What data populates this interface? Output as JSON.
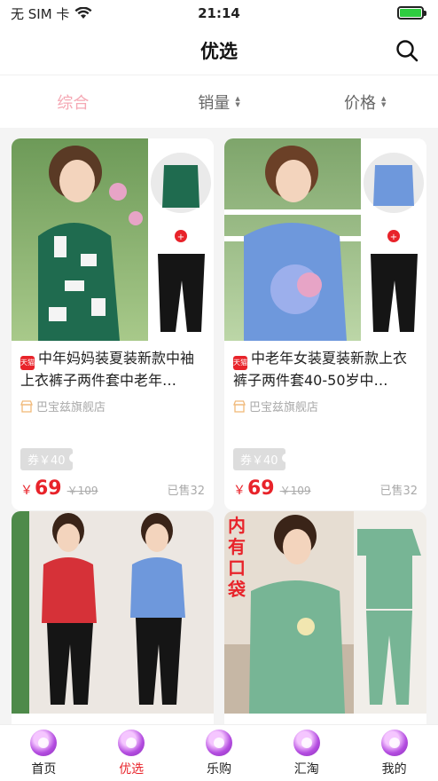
{
  "status": {
    "carrier": "无 SIM 卡",
    "time": "21:14"
  },
  "nav": {
    "title": "优选"
  },
  "filters": [
    {
      "label": "综合",
      "active": true
    },
    {
      "label": "销量",
      "active": false
    },
    {
      "label": "价格",
      "active": false
    }
  ],
  "products": [
    {
      "title": "中年妈妈装夏装新款中袖上衣裤子两件套中老年…",
      "badge": "天猫",
      "shop": "巴宝兹旗舰店",
      "coupon": "券￥40",
      "currency": "￥",
      "price": "69",
      "original_price": "￥109",
      "sold": "已售32",
      "top_color": "#2b6e55"
    },
    {
      "title": "中老年女装夏装新款上衣裤子两件套40-50岁中…",
      "badge": "天猫",
      "shop": "巴宝兹旗舰店",
      "coupon": "券￥40",
      "currency": "￥",
      "price": "69",
      "original_price": "￥109",
      "sold": "已售32",
      "top_color": "#6e98dc"
    },
    {
      "title": "",
      "badge": "",
      "shop": "",
      "coupon": "",
      "currency": "",
      "price": "",
      "original_price": "",
      "sold": "",
      "top_color": "#d63138"
    },
    {
      "title": "",
      "badge": "",
      "shop": "",
      "coupon": "",
      "currency": "",
      "price": "",
      "original_price": "",
      "sold": "",
      "top_color": "#77b595",
      "overlay_text": "内有口袋"
    }
  ],
  "tabs": [
    {
      "label": "首页",
      "icon": "home-icon",
      "active": false
    },
    {
      "label": "优选",
      "icon": "selected-icon",
      "active": true
    },
    {
      "label": "乐购",
      "icon": "shopping-icon",
      "active": false
    },
    {
      "label": "汇淘",
      "icon": "deals-icon",
      "active": false
    },
    {
      "label": "我的",
      "icon": "profile-icon",
      "active": false
    }
  ],
  "colors": {
    "accent": "#e8232a",
    "active_filter": "#f5a8b4",
    "tab_icon": "#b44de0"
  }
}
